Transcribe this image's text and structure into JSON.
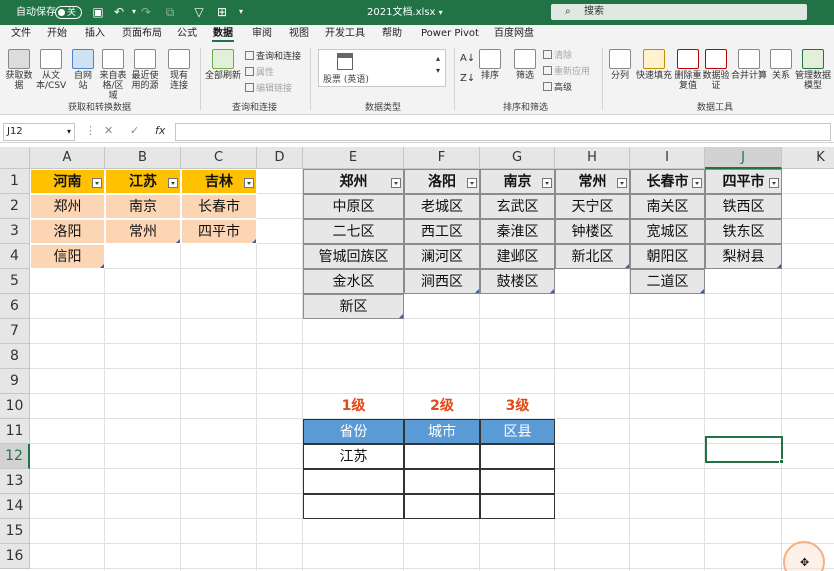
{
  "titlebar": {
    "autosave_label": "自动保存",
    "autosave_state": "关",
    "filename": "2021文档.xlsx",
    "search_placeholder": "搜索",
    "bg_color": "#217346"
  },
  "menu": {
    "items": [
      "文件",
      "开始",
      "插入",
      "页面布局",
      "公式",
      "数据",
      "审阅",
      "视图",
      "开发工具",
      "帮助",
      "Power Pivot",
      "百度网盘"
    ],
    "active": "数据"
  },
  "ribbon": {
    "get_transform": {
      "buttons": [
        "获取数据",
        "从文本/CSV",
        "自网站",
        "来自表格/区域",
        "最近使用的源",
        "现有连接"
      ],
      "group_label": "获取和转换数据"
    },
    "queries": {
      "refresh": "全部刷新",
      "small": [
        "查询和连接",
        "属性",
        "编辑链接"
      ],
      "group_label": "查询和连接"
    },
    "datatypes": {
      "stock": "股票 (英语)",
      "group_label": "数据类型"
    },
    "sort_filter": {
      "sort": "排序",
      "filter": "筛选",
      "small": [
        "清除",
        "重新应用",
        "高级"
      ],
      "group_label": "排序和筛选"
    },
    "data_tools": {
      "buttons": [
        "分列",
        "快速填充",
        "删除重复值",
        "数据验证",
        "合并计算",
        "关系",
        "管理数据模型"
      ],
      "group_label": "数据工具"
    }
  },
  "formula_bar": {
    "name_box": "J12",
    "fx": "fx",
    "formula": ""
  },
  "columns": [
    "A",
    "B",
    "C",
    "D",
    "E",
    "F",
    "G",
    "H",
    "I",
    "J",
    "K"
  ],
  "selected_column": "J",
  "rows": [
    "1",
    "2",
    "3",
    "4",
    "5",
    "6",
    "7",
    "8",
    "9",
    "10",
    "11",
    "12",
    "13",
    "14",
    "15",
    "16"
  ],
  "selected_row": "12",
  "province_table": {
    "headers": [
      "河南",
      "江苏",
      "吉林"
    ],
    "columns": [
      [
        "郑州",
        "洛阳",
        "信阳"
      ],
      [
        "南京",
        "常州"
      ],
      [
        "长春市",
        "四平市"
      ]
    ]
  },
  "city_table": {
    "headers": [
      "郑州",
      "洛阳",
      "南京",
      "常州",
      "长春市",
      "四平市"
    ],
    "columns": [
      [
        "中原区",
        "二七区",
        "管城回族区",
        "金水区",
        "新区"
      ],
      [
        "老城区",
        "西工区",
        "澜河区",
        "涧西区"
      ],
      [
        "玄武区",
        "秦淮区",
        "建邺区",
        "鼓楼区"
      ],
      [
        "天宁区",
        "钟楼区",
        "新北区"
      ],
      [
        "南关区",
        "宽城区",
        "朝阳区",
        "二道区"
      ],
      [
        "铁西区",
        "铁东区",
        "梨树县"
      ]
    ]
  },
  "entry_table": {
    "levels": [
      "1级",
      "2级",
      "3级"
    ],
    "headers": [
      "省份",
      "城市",
      "区县"
    ],
    "rows": [
      [
        "江苏",
        "",
        ""
      ],
      [
        "",
        "",
        ""
      ],
      [
        "",
        "",
        ""
      ]
    ]
  },
  "colors": {
    "excel_green": "#217346",
    "header_yellow": "#ffc000",
    "cell_orange": "#fcd5b4",
    "header_blue": "#5b9bd5",
    "level_red": "#e04a16"
  }
}
